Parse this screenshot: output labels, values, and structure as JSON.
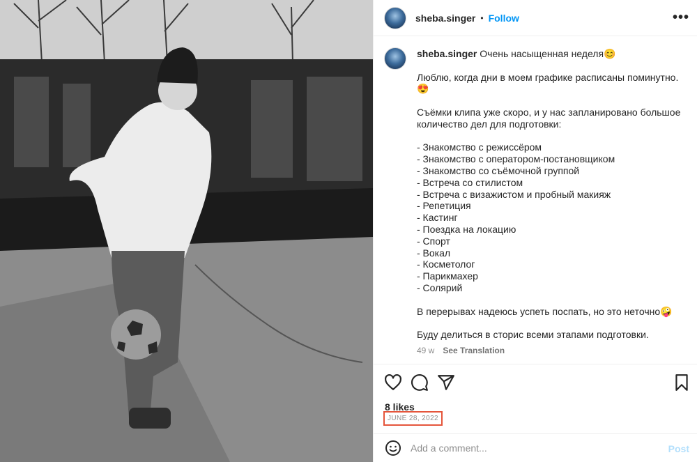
{
  "photo": {
    "alt_icon": "photo-football-player"
  },
  "header": {
    "username": "sheba.singer",
    "separator": "•",
    "follow_label": "Follow",
    "more_icon": "more-options-icon"
  },
  "caption": {
    "username": "sheba.singer",
    "text": "Очень насыщенная неделя😊\n\nЛюблю, когда дни в моем графике расписаны поминутно.\n😍\n\nСъёмки клипа уже скоро, и у нас запланировано большое количество дел для подготовки:\n\n- Знакомство с режиссёром\n- Знакомство с оператором-постановщиком\n- Знакомство со съёмочной группой\n- Встреча со стилистом\n- Встреча с визажистом и пробный макияж\n- Репетиция\n- Кастинг\n- Поездка на локацию\n- Спорт\n- Вокал\n- Косметолог\n- Парикмахер\n- Солярий\n\nВ перерывах надеюсь успеть поспать, но это неточно🤪\n\nБуду делиться в сторис всеми этапами подготовки.",
    "age": "49 w",
    "see_translation": "See Translation"
  },
  "actions": {
    "like_icon": "heart-icon",
    "comment_icon": "comment-icon",
    "share_icon": "share-icon",
    "save_icon": "bookmark-icon"
  },
  "likes": "8 likes",
  "date": "JUNE 28, 2022",
  "comment": {
    "placeholder": "Add a comment...",
    "post_label": "Post",
    "emoji_icon": "emoji-icon"
  },
  "colors": {
    "accent": "#0095f6",
    "post_disabled": "#b2dffc",
    "highlight": "#e5553b"
  }
}
